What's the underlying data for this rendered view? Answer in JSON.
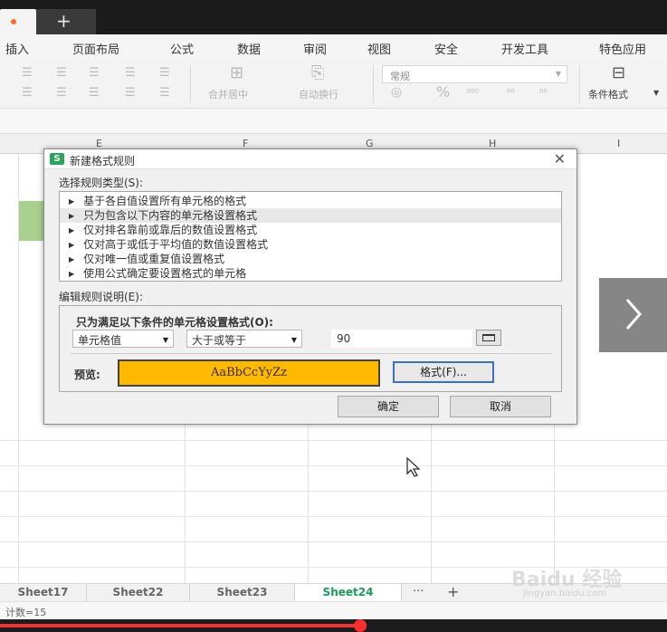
{
  "tabstrip": {
    "new_tab_glyph": "+"
  },
  "menu": {
    "items": [
      "插入",
      "页面布局",
      "公式",
      "数据",
      "审阅",
      "视图",
      "安全",
      "开发工具",
      "特色应用"
    ]
  },
  "ribbon": {
    "merge_label": "合并居中",
    "wrap_label": "自动换行",
    "number_format": "常规",
    "percent_glyph": "%",
    "conditional_format_label": "条件格式"
  },
  "grid": {
    "columns": [
      "E",
      "F",
      "G",
      "H",
      "I"
    ],
    "selected_cell_color": "#a9d08e"
  },
  "sheets": {
    "tabs": [
      "Sheet17",
      "Sheet22",
      "Sheet23",
      "Sheet24"
    ],
    "active_index": 3,
    "more_glyph": "···",
    "add_glyph": "+"
  },
  "status": {
    "count_text": "计数=15"
  },
  "watermark": {
    "brand": "Baidu 经验",
    "url": "jingyan.baidu.com"
  },
  "video": {
    "progress_fraction": 0.54
  },
  "dialog": {
    "title": "新建格式规则",
    "close_glyph": "✕",
    "rule_type_label": "选择规则类型(S):",
    "rule_types": [
      "基于各自值设置所有单元格的格式",
      "只为包含以下内容的单元格设置格式",
      "仅对排名靠前或靠后的数值设置格式",
      "仅对高于或低于平均值的数值设置格式",
      "仅对唯一值或重复值设置格式",
      "使用公式确定要设置格式的单元格"
    ],
    "selected_rule_index": 1,
    "edit_desc_label": "编辑规则说明(E):",
    "condition_title": "只为满足以下条件的单元格设置格式(O):",
    "combo_1": "单元格值",
    "combo_2": "大于或等于",
    "value": "90",
    "preview_label": "预览:",
    "preview_text": "AaBbCcYyZz",
    "preview_fill": "#ffba00",
    "format_button": "格式(F)...",
    "ok_button": "确定",
    "cancel_button": "取消"
  },
  "colors": {
    "accent_green": "#1d9a58",
    "wps_logo": "#2aa55b",
    "focus_blue": "#3b6fc0"
  }
}
